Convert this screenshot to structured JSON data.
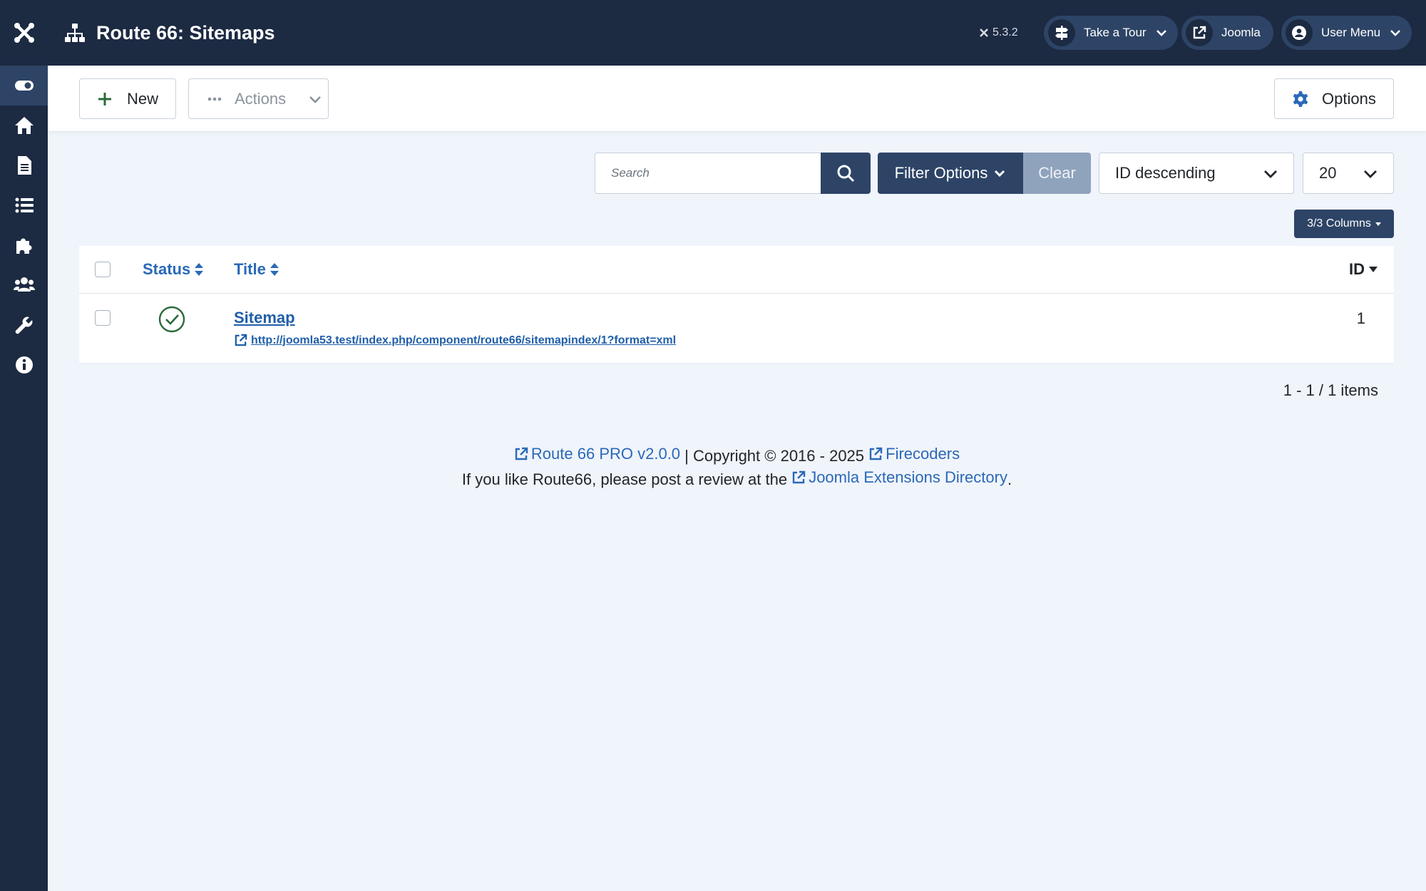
{
  "header": {
    "page_title": "Route 66: Sitemaps",
    "version": "5.3.2",
    "tour_label": "Take a Tour",
    "joomla_label": "Joomla",
    "user_menu_label": "User Menu"
  },
  "sidebar": {
    "items": [
      {
        "icon": "toggle-icon",
        "active": true
      },
      {
        "icon": "home-icon"
      },
      {
        "icon": "file-icon"
      },
      {
        "icon": "list-icon"
      },
      {
        "icon": "puzzle-icon"
      },
      {
        "icon": "users-icon"
      },
      {
        "icon": "wrench-icon"
      },
      {
        "icon": "info-icon"
      }
    ]
  },
  "toolbar": {
    "new_label": "New",
    "actions_label": "Actions",
    "options_label": "Options"
  },
  "filters": {
    "search_placeholder": "Search",
    "filter_options_label": "Filter Options",
    "clear_label": "Clear",
    "order_value": "ID descending",
    "limit_value": "20",
    "columns_label": "3/3 Columns"
  },
  "table": {
    "headers": {
      "status": "Status",
      "title": "Title",
      "id": "ID"
    },
    "rows": [
      {
        "status": "published",
        "title": "Sitemap",
        "url": "http://joomla53.test/index.php/component/route66/sitemapindex/1?format=xml",
        "id": "1"
      }
    ]
  },
  "pagination": {
    "info": "1 - 1 / 1 items"
  },
  "footer": {
    "product_link": "Route 66 PRO v2.0.0",
    "copyright": "| Copyright © 2016 - 2025",
    "company_link": "Firecoders",
    "review_text": "If you like Route66, please post a review at the",
    "jed_link": "Joomla Extensions Directory",
    "period": "."
  },
  "colors": {
    "sidebar_bg": "#1c2a42",
    "primary": "#2d4466",
    "link": "#2a69b8",
    "success": "#2a6b3a"
  }
}
